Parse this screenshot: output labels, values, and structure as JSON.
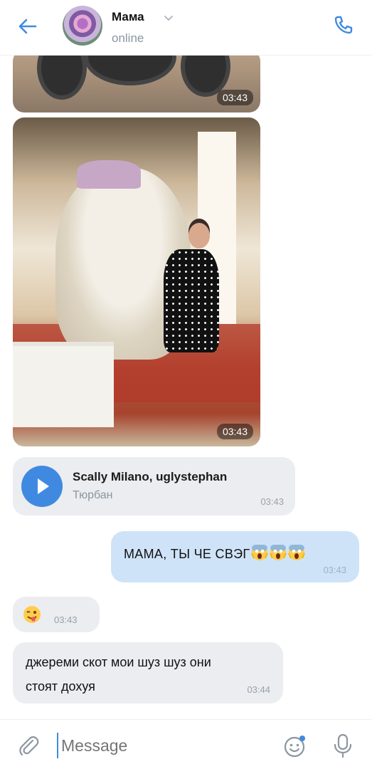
{
  "header": {
    "contact_name": "Мама",
    "status": "online",
    "avatar": "avatar-flowers-image",
    "icons": {
      "back": "arrow-left-icon",
      "call": "phone-icon",
      "chevron": "chevron-down-icon"
    },
    "accent_color": "#3f8ae0"
  },
  "messages": {
    "photo1": {
      "time": "03:43"
    },
    "photo2": {
      "time": "03:43"
    },
    "audio": {
      "title": "Scally Milano, uglystephan",
      "artist": "Тюрбан",
      "time": "03:43"
    },
    "outgoing": {
      "text": "МАМА, ТЫ ЧЕ СВЭГ",
      "emoji": [
        "😱",
        "😱",
        "😱"
      ],
      "time": "03:43"
    },
    "wink": {
      "emoji": "😜",
      "time": "03:43"
    },
    "text": {
      "line1": "джереми скот мои шуз шуз они",
      "line2": "стоят дохуя",
      "time": "03:44"
    }
  },
  "composer": {
    "placeholder": "Message",
    "icons": {
      "attach": "paperclip-icon",
      "emoji": "emoji-smile-icon",
      "mic": "microphone-icon"
    }
  },
  "colors": {
    "incoming_bubble": "#ebedf0",
    "outgoing_bubble": "#cfe3f8",
    "muted_text": "#8c96a0"
  }
}
